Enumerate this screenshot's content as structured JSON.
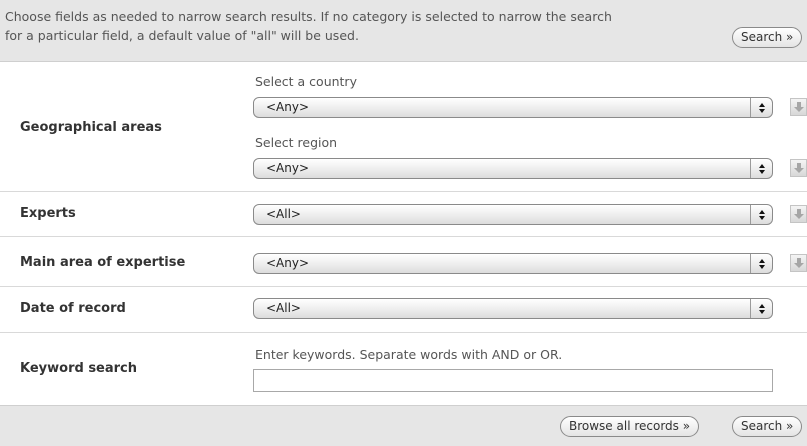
{
  "intro": {
    "line1": "Choose fields as needed to narrow search results. If no category is selected to narrow the search",
    "line2": "for a particular field, a default value of \"all\" will be used."
  },
  "buttons": {
    "search": "Search »",
    "browse_all": "Browse all records »"
  },
  "geo": {
    "label": "Geographical areas",
    "country_label": "Select a country",
    "country_value": "<Any>",
    "region_label": "Select region",
    "region_value": "<Any>"
  },
  "experts": {
    "label": "Experts",
    "value": "<All>"
  },
  "expertise": {
    "label": "Main area of expertise",
    "value": "<Any>"
  },
  "date": {
    "label": "Date of record",
    "value": "<All>"
  },
  "keyword": {
    "label": "Keyword search",
    "hint": "Enter keywords. Separate words with AND or OR.",
    "value": ""
  }
}
